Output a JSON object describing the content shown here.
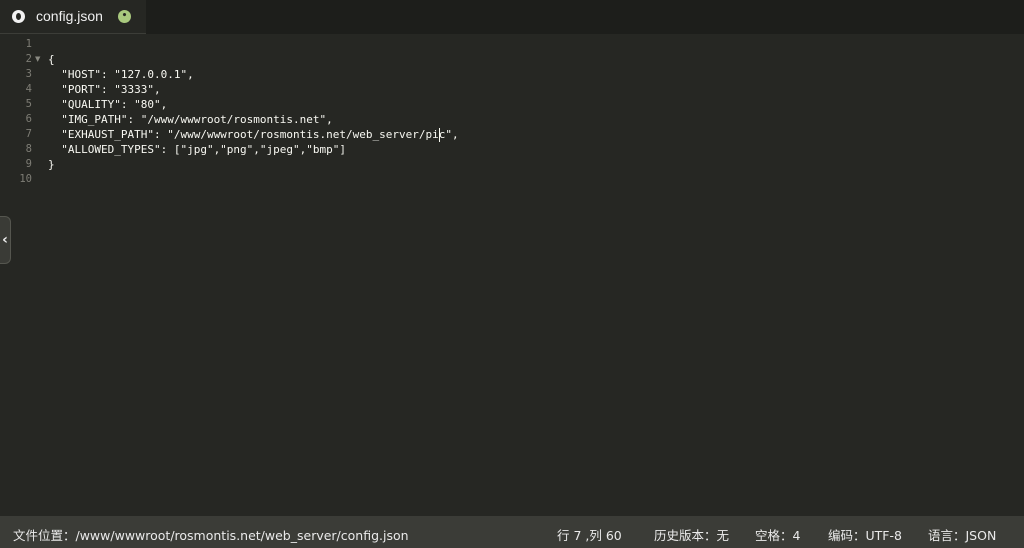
{
  "tab": {
    "title": "config.json",
    "file_icon": "file-icon",
    "modified_icon": "dot-icon"
  },
  "editor": {
    "line_numbers": [
      "1",
      "2",
      "3",
      "4",
      "5",
      "6",
      "7",
      "8",
      "9",
      "10"
    ],
    "fold_line": 2,
    "lines": [
      "",
      "{",
      "  \"HOST\": \"127.0.0.1\",",
      "  \"PORT\": \"3333\",",
      "  \"QUALITY\": \"80\",",
      "  \"IMG_PATH\": \"/www/wwwroot/rosmontis.net\",",
      "  \"EXHAUST_PATH\": \"/www/wwwroot/rosmontis.net/web_server/pic\",",
      "  \"ALLOWED_TYPES\": [\"jpg\",\"png\",\"jpeg\",\"bmp\"]",
      "}",
      ""
    ],
    "cursor": {
      "line": 7,
      "column": 60
    }
  },
  "statusbar": {
    "path": "文件位置：/www/wwwroot/rosmontis.net/web_server/config.json",
    "position": "行 7 ,列 60",
    "history": "历史版本：无",
    "spaces": "空格：4",
    "encoding": "编码：UTF-8",
    "language": "语言：JSON"
  },
  "colors": {
    "background": "#262723",
    "tabbar": "#1d1e1b",
    "statusbar": "#3b3c37",
    "string": "#e6db74",
    "line_number": "#7e7d75"
  }
}
